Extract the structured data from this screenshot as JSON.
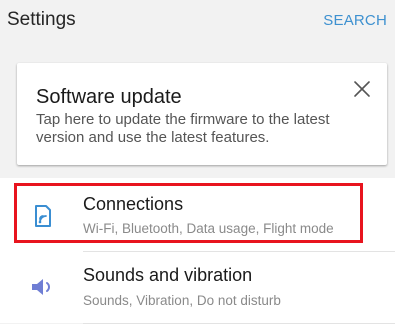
{
  "header": {
    "title": "Settings",
    "search_label": "SEARCH",
    "accent_color": "#3e91d0"
  },
  "update_card": {
    "title": "Software update",
    "body": "Tap here to update the firmware to the latest version and use the latest features.",
    "close_icon": "close-icon"
  },
  "settings_list": {
    "items": [
      {
        "title": "Connections",
        "subtitle": "Wi-Fi, Bluetooth, Data usage, Flight mode",
        "icon": "connections-icon",
        "highlighted": true
      },
      {
        "title": "Sounds and vibration",
        "subtitle": "Sounds, Vibration, Do not disturb",
        "icon": "speaker-icon",
        "highlighted": false
      }
    ]
  },
  "highlight_color": "#e8141e"
}
